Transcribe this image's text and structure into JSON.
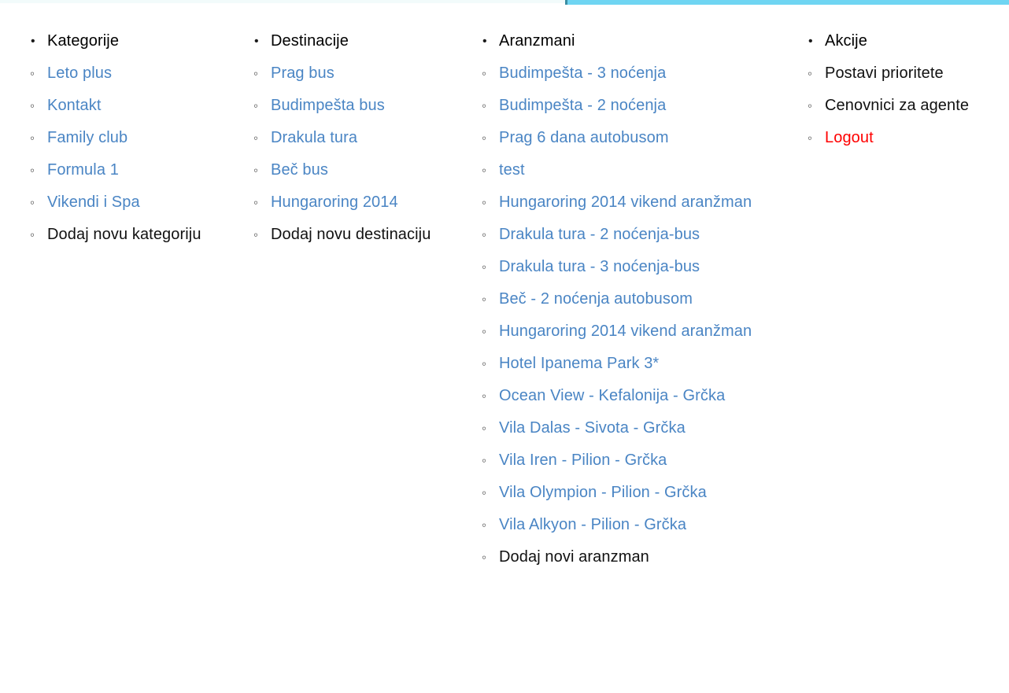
{
  "page": {
    "background": "#ffffff",
    "accent_bar_color": "#6fd5f2",
    "link_color": "#4a85c4",
    "danger_color": "#ff0000",
    "text_color": "#111111"
  },
  "columns": [
    {
      "header": "Kategorije",
      "items": [
        {
          "label": "Leto plus",
          "style": "link"
        },
        {
          "label": "Kontakt",
          "style": "link"
        },
        {
          "label": "Family club",
          "style": "link"
        },
        {
          "label": "Formula 1",
          "style": "link"
        },
        {
          "label": "Vikendi i Spa",
          "style": "link"
        },
        {
          "label": "Dodaj novu kategoriju",
          "style": "plain"
        }
      ]
    },
    {
      "header": "Destinacije",
      "items": [
        {
          "label": "Prag bus",
          "style": "link"
        },
        {
          "label": "Budimpešta bus",
          "style": "link"
        },
        {
          "label": "Drakula tura",
          "style": "link"
        },
        {
          "label": "Beč bus",
          "style": "link"
        },
        {
          "label": "Hungaroring 2014",
          "style": "link"
        },
        {
          "label": "Dodaj novu destinaciju",
          "style": "plain"
        }
      ]
    },
    {
      "header": "Aranzmani",
      "items": [
        {
          "label": "Budimpešta - 3 noćenja",
          "style": "link"
        },
        {
          "label": "Budimpešta - 2 noćenja",
          "style": "link"
        },
        {
          "label": "Prag 6 dana autobusom",
          "style": "link"
        },
        {
          "label": "test",
          "style": "link"
        },
        {
          "label": "Hungaroring 2014 vikend aranžman",
          "style": "link"
        },
        {
          "label": "Drakula tura - 2 noćenja-bus",
          "style": "link"
        },
        {
          "label": "Drakula tura - 3 noćenja-bus",
          "style": "link"
        },
        {
          "label": "Beč - 2 noćenja autobusom",
          "style": "link"
        },
        {
          "label": "Hungaroring 2014 vikend aranžman",
          "style": "link"
        },
        {
          "label": "Hotel Ipanema Park 3*",
          "style": "link"
        },
        {
          "label": "Ocean View - Kefalonija - Grčka",
          "style": "link"
        },
        {
          "label": "Vila Dalas - Sivota - Grčka",
          "style": "link"
        },
        {
          "label": "Vila Iren - Pilion - Grčka",
          "style": "link"
        },
        {
          "label": "Vila Olympion - Pilion - Grčka",
          "style": "link"
        },
        {
          "label": "Vila Alkyon - Pilion - Grčka",
          "style": "link"
        },
        {
          "label": "Dodaj novi aranzman",
          "style": "plain"
        }
      ]
    },
    {
      "header": "Akcije",
      "items": [
        {
          "label": "Postavi prioritete",
          "style": "plain"
        },
        {
          "label": "Cenovnici za agente",
          "style": "plain"
        },
        {
          "label": "Logout",
          "style": "danger"
        }
      ]
    }
  ]
}
